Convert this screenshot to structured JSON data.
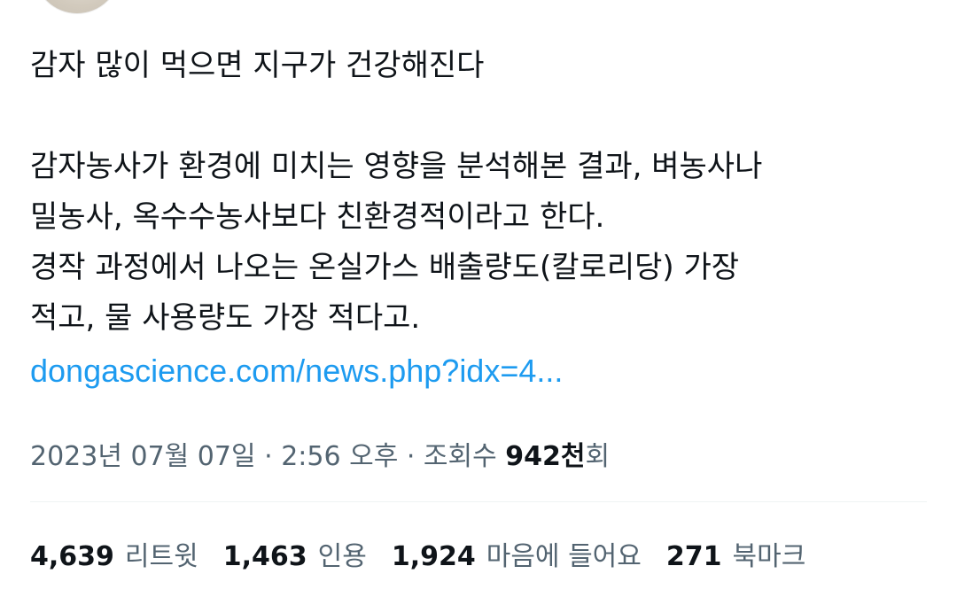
{
  "tweet": {
    "headline": "감자 많이 먹으면 지구가 건강해진다",
    "body_lines": [
      "감자농사가 환경에 미치는 영향을 분석해본 결과, 벼농사나",
      "밀농사, 옥수수농사보다 친환경적이라고 한다.",
      "경작 과정에서 나오는 온실가스 배출량도(칼로리당) 가장",
      "적고, 물 사용량도 가장 적다고."
    ],
    "link_text": "dongascience.com/news.php?idx=4..."
  },
  "meta": {
    "date": "2023년 07월 07일",
    "separator1": " · ",
    "time": "2:56 오후",
    "separator2": " · ",
    "views_label": "조회수 ",
    "views_count": "942천",
    "views_suffix": "회"
  },
  "stats": [
    {
      "count": "4,639",
      "label": "리트윗"
    },
    {
      "count": "1,463",
      "label": "인용"
    },
    {
      "count": "1,924",
      "label": "마음에 들어요"
    },
    {
      "count": "271",
      "label": "북마크"
    }
  ]
}
